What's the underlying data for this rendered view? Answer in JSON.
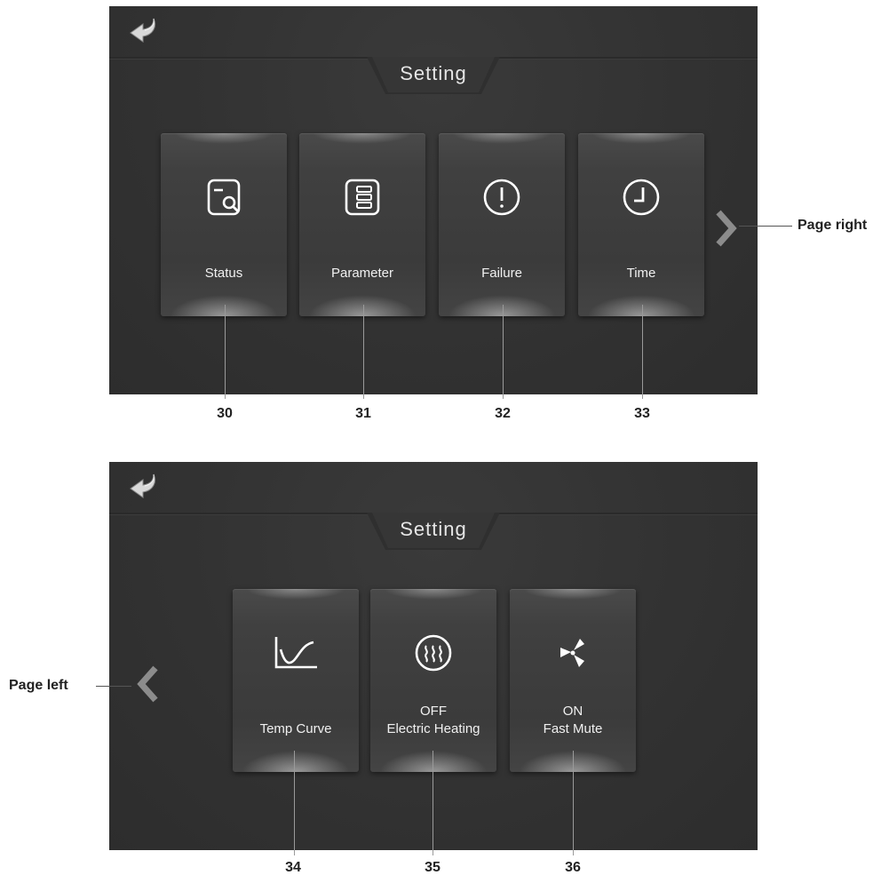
{
  "top_screen": {
    "title": "Setting",
    "cards": [
      {
        "label": "Status",
        "icon": "status-search-icon",
        "callout": "30"
      },
      {
        "label": "Parameter",
        "icon": "parameter-list-icon",
        "callout": "31"
      },
      {
        "label": "Failure",
        "icon": "failure-alert-icon",
        "callout": "32"
      },
      {
        "label": "Time",
        "icon": "clock-icon",
        "callout": "33"
      }
    ],
    "page_right_label": "Page right"
  },
  "bottom_screen": {
    "title": "Setting",
    "cards": [
      {
        "label": "Temp Curve",
        "icon": "temp-curve-icon",
        "callout": "34"
      },
      {
        "state": "OFF",
        "label": "Electric Heating",
        "icon": "electric-heating-icon",
        "callout": "35"
      },
      {
        "state": "ON",
        "label": "Fast Mute",
        "icon": "fan-icon",
        "callout": "36"
      }
    ],
    "page_left_label": "Page left"
  }
}
